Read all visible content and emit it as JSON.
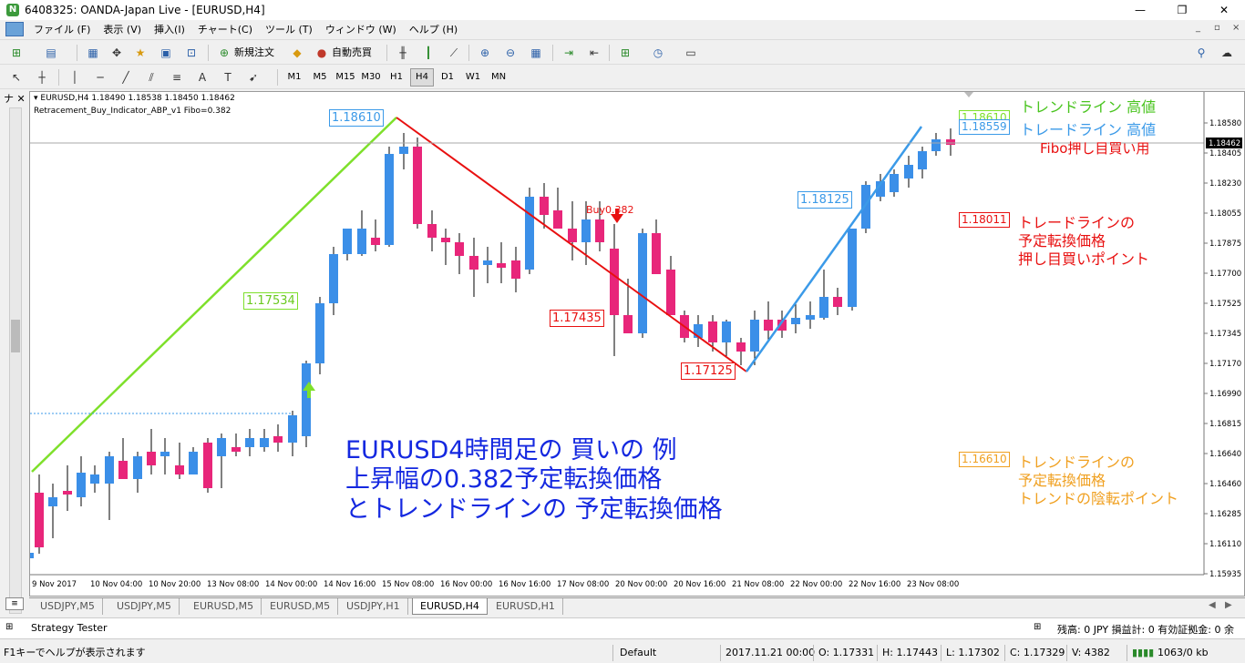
{
  "window": {
    "title": "6408325: OANDA-Japan Live - [EURUSD,H4]"
  },
  "menu": [
    "ファイル (F)",
    "表示 (V)",
    "挿入(I)",
    "チャート(C)",
    "ツール (T)",
    "ウィンドウ (W)",
    "ヘルプ (H)"
  ],
  "toolbar": {
    "new_order": "新規注文",
    "auto_trade": "自動売買"
  },
  "timeframes": [
    "M1",
    "M5",
    "M15",
    "M30",
    "H1",
    "H4",
    "D1",
    "W1",
    "MN"
  ],
  "active_timeframe": "H4",
  "chart": {
    "header_line1": "EURUSD,H4  1.18490 1.18538 1.18450 1.18462",
    "header_line2": "Retracement_Buy_Indicator_ABP_v1 Fibo=0.382",
    "price_axis": [
      "1.18580",
      "1.18405",
      "1.18230",
      "1.18055",
      "1.17875",
      "1.17700",
      "1.17525",
      "1.17345",
      "1.17170",
      "1.16990",
      "1.16815",
      "1.16640",
      "1.16460",
      "1.16285",
      "1.16110",
      "1.15935"
    ],
    "current_price": "1.18462",
    "time_axis": [
      "9 Nov 2017",
      "10 Nov 04:00",
      "10 Nov 20:00",
      "13 Nov 08:00",
      "14 Nov 00:00",
      "14 Nov 16:00",
      "15 Nov 08:00",
      "16 Nov 00:00",
      "16 Nov 16:00",
      "17 Nov 08:00",
      "20 Nov 00:00",
      "20 Nov 16:00",
      "21 Nov 08:00",
      "22 Nov 00:00",
      "22 Nov 16:00",
      "23 Nov 08:00"
    ],
    "price_labels": {
      "high1": "1.18610",
      "mid_green": "1.17534",
      "low_red1": "1.17435",
      "low_red2": "1.17125",
      "blue_mid": "1.18125",
      "buy_signal": "Buy0.382",
      "right_green": "1.18610",
      "right_blue": "1.18559",
      "right_red": "1.18011",
      "right_orange": "1.16610"
    },
    "annotations": {
      "trend_high": "トレンドライン 高値",
      "trade_high": "トレードライン 高値",
      "fibo": "Fibo押し目買い用",
      "red1": "トレードラインの",
      "red2": "予定転換価格",
      "red3": "押し目買いポイント",
      "orange1": "トレンドラインの",
      "orange2": "予定転換価格",
      "orange3": "トレンドの陰転ポイント",
      "main1": "EURUSD4時間足の 買いの 例",
      "main2": "上昇幅の0.382予定転換価格",
      "main3": "とトレンドラインの 予定転換価格"
    },
    "colors": {
      "bull": "#3b8fe8",
      "bear": "#e8267a",
      "green_line": "#7ee02b",
      "red_line": "#e81010",
      "blue_line": "#3b9ae8",
      "orange": "#f0a020"
    }
  },
  "chart_tabs": [
    "USDJPY,M5",
    "USDJPY,M5",
    "EURUSD,M5",
    "EURUSD,M5",
    "USDJPY,H1",
    "EURUSD,H4",
    "EURUSD,H1"
  ],
  "active_chart_tab": "EURUSD,H4",
  "terminal": {
    "strategy_tester": "Strategy Tester",
    "account": "残高: 0 JPY  損益計: 0  有効証拠金: 0  余"
  },
  "status": {
    "help": "F1キーでヘルプが表示されます",
    "profile": "Default",
    "datetime": "2017.11.21 00:00",
    "open": "O: 1.17331",
    "high": "H: 1.17443",
    "low": "L: 1.17302",
    "close": "C: 1.17329",
    "volume": "V: 4382",
    "traffic": "1063/0 kb"
  }
}
